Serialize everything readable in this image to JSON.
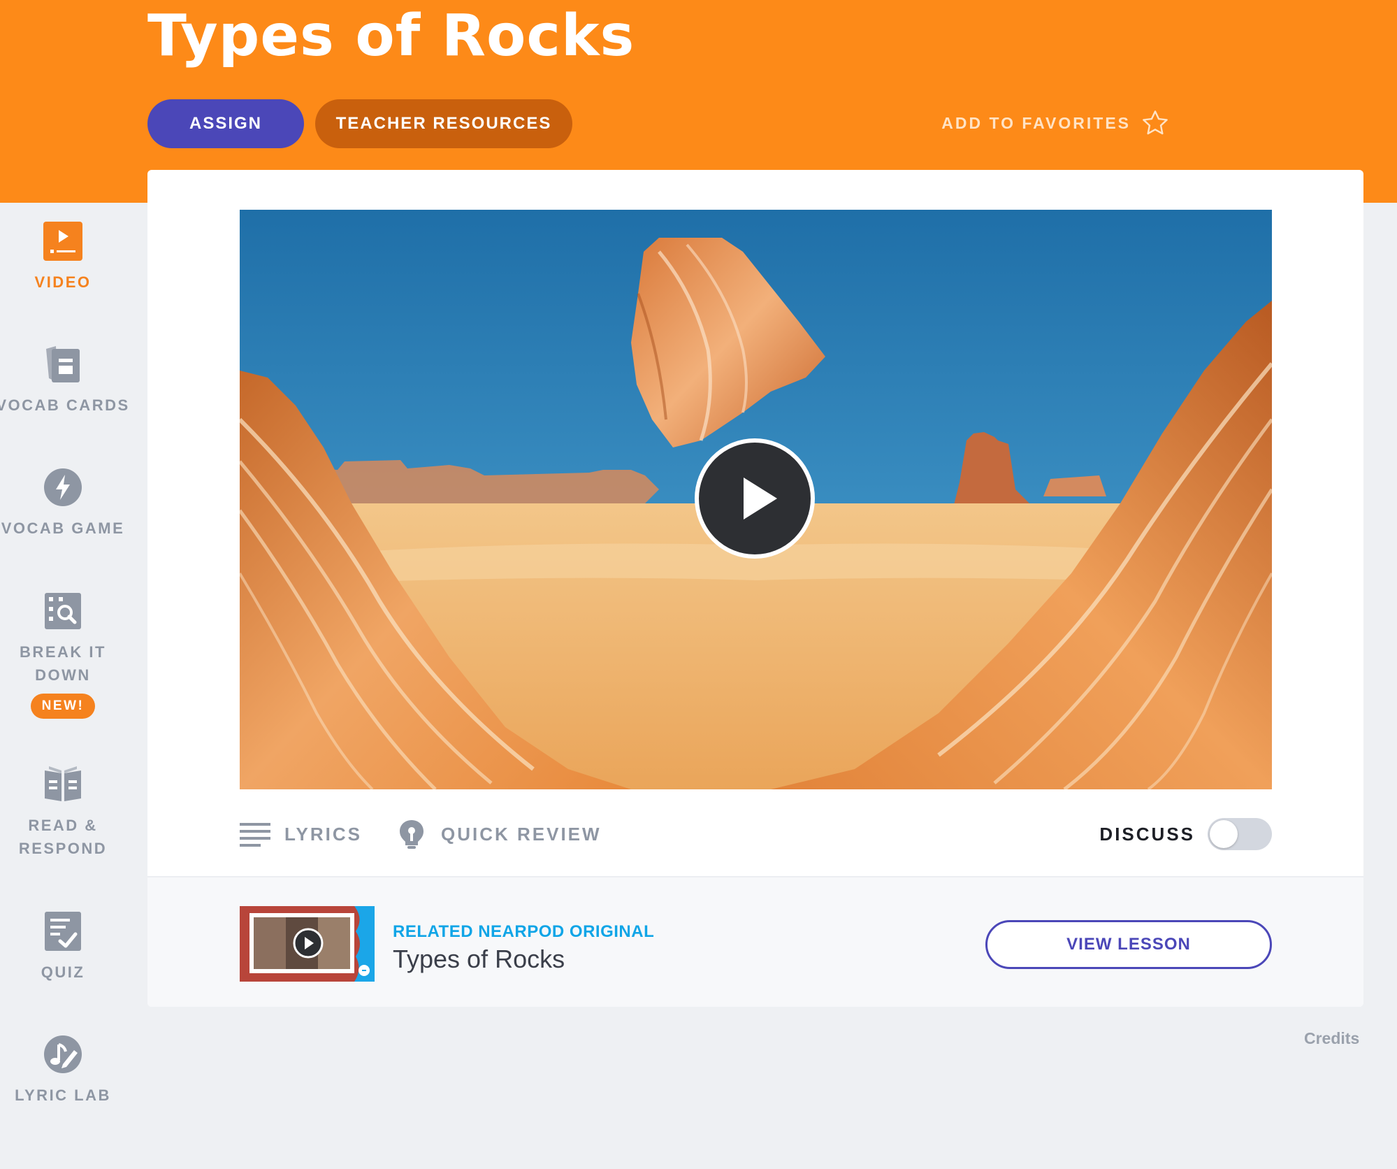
{
  "header": {
    "title": "Types of Rocks",
    "assign_label": "ASSIGN",
    "teacher_resources_label": "TEACHER RESOURCES",
    "add_to_favorites_label": "ADD TO FAVORITES",
    "favorites_icon": "star-outline-icon"
  },
  "sidebar": {
    "items": [
      {
        "label": "VIDEO",
        "icon": "video-play-icon",
        "active": true
      },
      {
        "label": "VOCAB CARDS",
        "icon": "vocab-cards-icon",
        "active": false
      },
      {
        "label": "VOCAB GAME",
        "icon": "lightning-bolt-icon",
        "active": false
      },
      {
        "label_line1": "BREAK IT",
        "label_line2": "DOWN",
        "icon": "magnify-grid-icon",
        "active": false,
        "badge": "NEW!"
      },
      {
        "label_line1": "READ &",
        "label_line2": "RESPOND",
        "icon": "open-book-icon",
        "active": false
      },
      {
        "label": "QUIZ",
        "icon": "quiz-checklist-icon",
        "active": false
      },
      {
        "label": "LYRIC LAB",
        "icon": "music-note-pencil-icon",
        "active": false
      }
    ]
  },
  "video": {
    "play_icon": "play-icon"
  },
  "toolbar": {
    "lyrics_label": "LYRICS",
    "quick_review_label": "QUICK REVIEW",
    "discuss_label": "DISCUSS",
    "discuss_on": false
  },
  "related": {
    "kicker": "RELATED NEARPOD ORIGINAL",
    "title": "Types of Rocks",
    "view_lesson_label": "VIEW LESSON"
  },
  "footer": {
    "credits_label": "Credits"
  },
  "colors": {
    "header_orange": "#fd8a18",
    "assign_purple": "#4b47b8",
    "teacher_brown": "#c9600d",
    "active_orange": "#f5821e",
    "inactive_gray": "#8e96a3",
    "nearpod_blue": "#10a5e7"
  }
}
